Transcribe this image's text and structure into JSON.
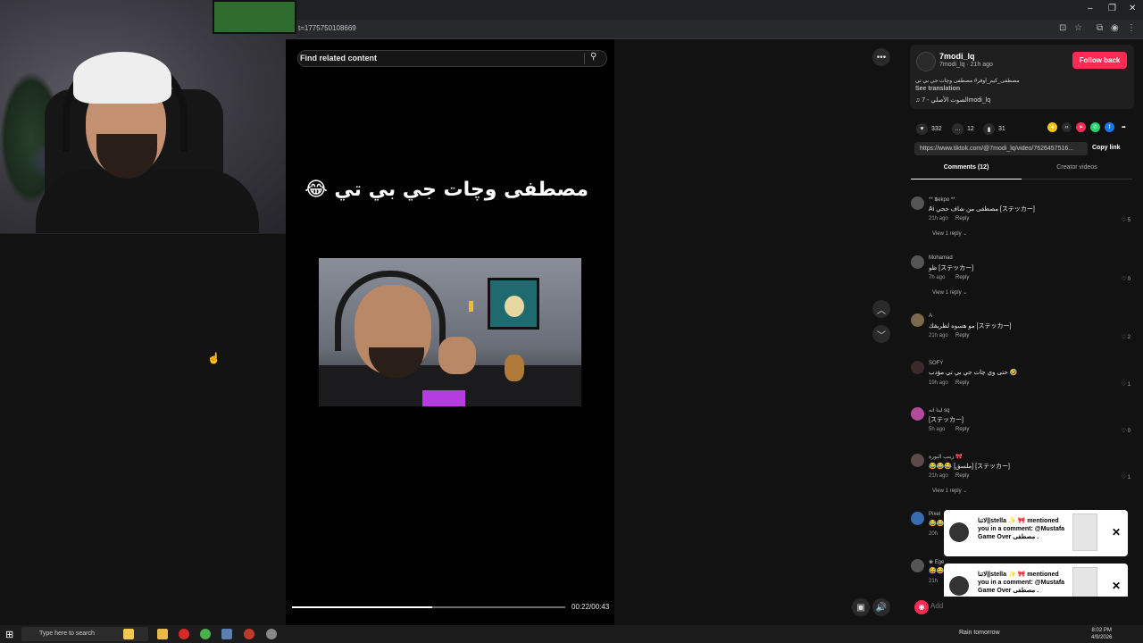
{
  "browser": {
    "url": "t=1775750108669",
    "controls": {
      "minimize": "–",
      "restore": "❐",
      "close": "✕"
    }
  },
  "video": {
    "search_placeholder": "Find related content",
    "caption": "مصطفى وچات جي بي تي 😂",
    "time": "00:22/00:43",
    "progress_fraction": 0.5116
  },
  "creator": {
    "name": "7modi_lq",
    "handle": "7modi_lq · 21h ago",
    "follow_label": "Follow back",
    "description": "مصطفى_كيم_اوفر# مصطفى وچات جي بي تي",
    "see_translation": "See translation",
    "music": "♫  الصوت الأصلي - 7modi_lq"
  },
  "stats": {
    "likes": "332",
    "comments": "12",
    "saves": "31"
  },
  "share_link": {
    "url": "https://www.tiktok.com/@7modi_lq/video/7626457516...",
    "copy_label": "Copy link"
  },
  "tabs": {
    "comments": "Comments (12)",
    "creator_videos": "Creator videos"
  },
  "comments": [
    {
      "user": "** ฿ekpo **",
      "text": "Ai مصطفى من شاف حجي [ステッカー]",
      "time": "21h ago",
      "reply": "Reply",
      "likes": "5",
      "view": "View 1 reply ⌄"
    },
    {
      "user": "Mohamad",
      "text": "ظو [ステッカー]",
      "time": "7h ago",
      "reply": "Reply",
      "likes": "0",
      "view": "View 1 reply ⌄"
    },
    {
      "user": "A",
      "text": "مو هسوه لطريقك [ステッカー]",
      "time": "21h ago",
      "reply": "Reply",
      "likes": "2",
      "view": ""
    },
    {
      "user": "SOFY",
      "text": "حتى وي چات جي بي تي مؤدب 🤣",
      "time": "19h ago",
      "reply": "Reply",
      "likes": "1",
      "view": ""
    },
    {
      "user": "لينا انه sq",
      "text": "[ステッカー]",
      "time": "5h ago",
      "reply": "Reply",
      "likes": "0",
      "view": ""
    },
    {
      "user": "زينب البورة 🎀",
      "text": "😂😂😂 [ملسق] [ステッカー]",
      "time": "21h ago",
      "reply": "Reply",
      "likes": "1",
      "view": "View 1 reply ⌄"
    },
    {
      "user": "Pixel",
      "text": "😂😂",
      "time": "20h",
      "reply": "",
      "likes": "",
      "view": ""
    },
    {
      "user": "❀ Ege",
      "text": "😂😂",
      "time": "21h",
      "reply": "",
      "likes": "",
      "view": ""
    }
  ],
  "notifications": [
    {
      "text": "لاتنا||stella ✨ 🎀 mentioned you in a comment: @Mustafa Game Over مصطفى ."
    },
    {
      "text": "لاتنا||stella ✨ 🎀 mentioned you in a comment: @Mustafa Game Over مصطفى ."
    }
  ],
  "comment_input": {
    "placeholder": "Add"
  },
  "taskbar": {
    "search_placeholder": "Type here to search",
    "weather": "Rain tomorrow",
    "time": "8:02 PM",
    "date": "4/9/2026"
  },
  "colors": {
    "accent": "#fe2c55",
    "background": "#121212"
  }
}
